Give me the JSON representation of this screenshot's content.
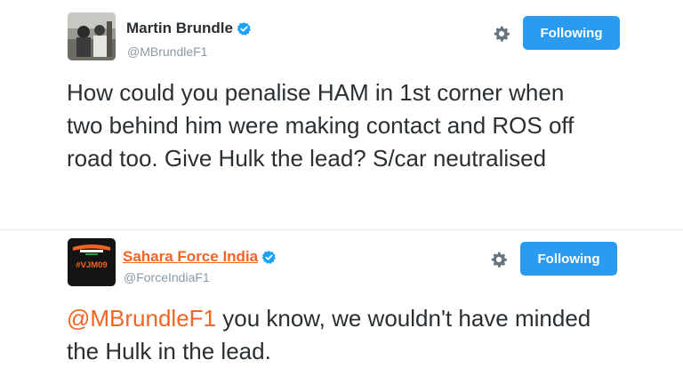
{
  "tweets": [
    {
      "author_name": "Martin Brundle",
      "author_handle": "@MBrundleF1",
      "verified": true,
      "follow_label": "Following",
      "text": "How could you penalise HAM in 1st corner when two behind him were making contact and ROS off road too. Give Hulk the lead? S/car neutralised"
    },
    {
      "author_name": "Sahara Force India",
      "author_handle": "@ForceIndiaF1",
      "verified": true,
      "follow_label": "Following",
      "avatar_text": "#VJM09",
      "mention": "@MBrundleF1",
      "text": " you know, we wouldn't have minded the Hulk in the lead."
    }
  ],
  "colors": {
    "follow_button": "#2b9bf0",
    "brand_link": "#f26522",
    "verified_badge": "#1da1f2",
    "handle": "#8899a6"
  }
}
